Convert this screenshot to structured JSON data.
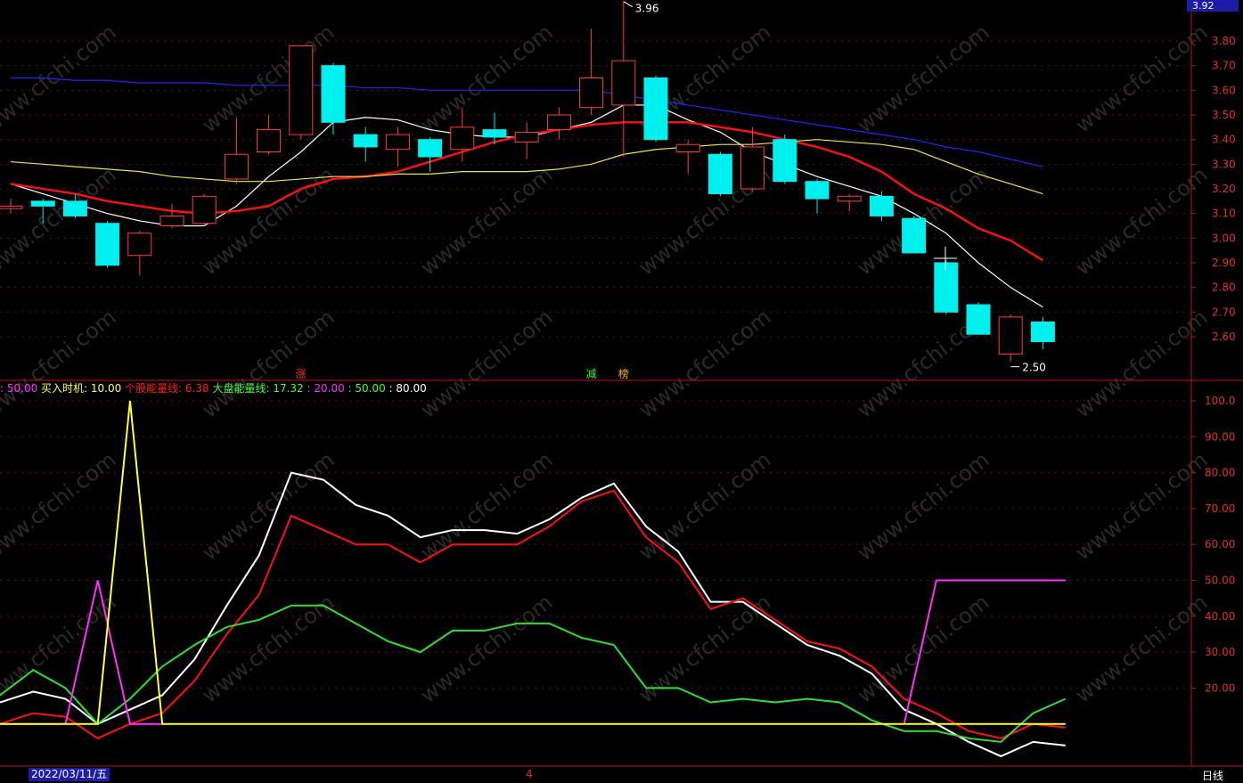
{
  "chart_data": [
    {
      "type": "candlestick",
      "price_axis": {
        "ylim": [
          2.45,
          3.96
        ],
        "ticks": [
          "3.80",
          "3.70",
          "3.60",
          "3.50",
          "3.40",
          "3.30",
          "3.20",
          "3.10",
          "3.00",
          "2.90",
          "2.80",
          "2.70",
          "2.60"
        ],
        "current_tag": "3.92"
      },
      "annotations": {
        "high_label": "3.96",
        "low_label": "2.50"
      },
      "candles": [
        {
          "o": 3.12,
          "c": 3.13,
          "h": 3.16,
          "l": 3.1
        },
        {
          "o": 3.15,
          "c": 3.13,
          "h": 3.16,
          "l": 3.06
        },
        {
          "o": 3.15,
          "c": 3.09,
          "h": 3.18,
          "l": 3.08
        },
        {
          "o": 3.06,
          "c": 2.89,
          "h": 3.07,
          "l": 2.88
        },
        {
          "o": 2.93,
          "c": 3.02,
          "h": 3.03,
          "l": 2.85
        },
        {
          "o": 3.05,
          "c": 3.09,
          "h": 3.14,
          "l": 3.04
        },
        {
          "o": 3.06,
          "c": 3.17,
          "h": 3.18,
          "l": 3.05
        },
        {
          "o": 3.24,
          "c": 3.34,
          "h": 3.49,
          "l": 3.22
        },
        {
          "o": 3.35,
          "c": 3.44,
          "h": 3.5,
          "l": 3.34
        },
        {
          "o": 3.42,
          "c": 3.78,
          "h": 3.78,
          "l": 3.4
        },
        {
          "o": 3.7,
          "c": 3.47,
          "h": 3.71,
          "l": 3.42
        },
        {
          "o": 3.42,
          "c": 3.37,
          "h": 3.45,
          "l": 3.31
        },
        {
          "o": 3.36,
          "c": 3.42,
          "h": 3.45,
          "l": 3.29
        },
        {
          "o": 3.4,
          "c": 3.33,
          "h": 3.41,
          "l": 3.27
        },
        {
          "o": 3.36,
          "c": 3.45,
          "h": 3.53,
          "l": 3.31
        },
        {
          "o": 3.44,
          "c": 3.41,
          "h": 3.51,
          "l": 3.38
        },
        {
          "o": 3.39,
          "c": 3.43,
          "h": 3.47,
          "l": 3.32
        },
        {
          "o": 3.44,
          "c": 3.5,
          "h": 3.53,
          "l": 3.4
        },
        {
          "o": 3.53,
          "c": 3.65,
          "h": 3.85,
          "l": 3.5
        },
        {
          "o": 3.54,
          "c": 3.72,
          "h": 3.96,
          "l": 3.33
        },
        {
          "o": 3.65,
          "c": 3.4,
          "h": 3.66,
          "l": 3.39
        },
        {
          "o": 3.35,
          "c": 3.38,
          "h": 3.4,
          "l": 3.26
        },
        {
          "o": 3.34,
          "c": 3.18,
          "h": 3.35,
          "l": 3.17
        },
        {
          "o": 3.2,
          "c": 3.37,
          "h": 3.45,
          "l": 3.19
        },
        {
          "o": 3.4,
          "c": 3.23,
          "h": 3.42,
          "l": 3.22
        },
        {
          "o": 3.23,
          "c": 3.16,
          "h": 3.24,
          "l": 3.1
        },
        {
          "o": 3.15,
          "c": 3.17,
          "h": 3.18,
          "l": 3.11
        },
        {
          "o": 3.17,
          "c": 3.09,
          "h": 3.19,
          "l": 3.07
        },
        {
          "o": 3.08,
          "c": 2.94,
          "h": 3.09,
          "l": 2.94
        },
        {
          "o": 2.9,
          "c": 2.7,
          "h": 2.91,
          "l": 2.69
        },
        {
          "o": 2.73,
          "c": 2.61,
          "h": 2.74,
          "l": 2.61
        },
        {
          "o": 2.53,
          "c": 2.68,
          "h": 2.69,
          "l": 2.5
        },
        {
          "o": 2.66,
          "c": 2.58,
          "h": 2.68,
          "l": 2.55
        }
      ],
      "series": [
        {
          "color": "#ffffff",
          "values": [
            3.22,
            3.18,
            3.14,
            3.1,
            3.07,
            3.05,
            3.05,
            3.13,
            3.25,
            3.35,
            3.47,
            3.49,
            3.48,
            3.44,
            3.42,
            3.41,
            3.41,
            3.44,
            3.47,
            3.54,
            3.54,
            3.48,
            3.43,
            3.35,
            3.3,
            3.25,
            3.21,
            3.17,
            3.1,
            3.02,
            2.9,
            2.8,
            2.72
          ]
        },
        {
          "color": "#ff1010",
          "values": [
            3.22,
            3.2,
            3.18,
            3.15,
            3.13,
            3.11,
            3.1,
            3.11,
            3.13,
            3.2,
            3.24,
            3.25,
            3.27,
            3.31,
            3.35,
            3.39,
            3.42,
            3.44,
            3.46,
            3.47,
            3.47,
            3.47,
            3.45,
            3.43,
            3.4,
            3.37,
            3.33,
            3.27,
            3.18,
            3.12,
            3.04,
            2.99,
            2.91
          ]
        },
        {
          "color": "#e8e844",
          "values": [
            3.31,
            3.3,
            3.29,
            3.28,
            3.27,
            3.25,
            3.24,
            3.23,
            3.23,
            3.24,
            3.25,
            3.25,
            3.26,
            3.26,
            3.27,
            3.27,
            3.27,
            3.28,
            3.3,
            3.34,
            3.36,
            3.37,
            3.38,
            3.38,
            3.39,
            3.4,
            3.39,
            3.38,
            3.36,
            3.31,
            3.26,
            3.22,
            3.18
          ]
        },
        {
          "color": "#2424ff",
          "values": [
            3.65,
            3.65,
            3.64,
            3.64,
            3.63,
            3.63,
            3.63,
            3.62,
            3.62,
            3.62,
            3.62,
            3.61,
            3.61,
            3.6,
            3.6,
            3.6,
            3.6,
            3.6,
            3.6,
            3.58,
            3.56,
            3.54,
            3.52,
            3.5,
            3.48,
            3.46,
            3.44,
            3.42,
            3.4,
            3.37,
            3.35,
            3.32,
            3.29
          ]
        }
      ],
      "events": [
        {
          "label": "涨",
          "color": "#ff3030",
          "index": 9
        },
        {
          "label": "减",
          "color": "#30ff30",
          "index": 18
        },
        {
          "label": "榜",
          "color": "#ffb020",
          "index": 19
        }
      ]
    },
    {
      "type": "line",
      "ylim": [
        0,
        104
      ],
      "ticks": [
        "100.0",
        "90.00",
        "80.00",
        "70.00",
        "60.00",
        "50.00",
        "40.00",
        "30.00",
        "20.00"
      ],
      "legend": [
        {
          "text": ": 50.00",
          "color": "#ff30ff"
        },
        {
          "text": " 买入时机: 10.00",
          "color": "#ffff40"
        },
        {
          "text": " 个股能量线: 6.38",
          "color": "#ff2020"
        },
        {
          "text": " 大盘能量线: 17.32",
          "color": "#40ff40"
        },
        {
          "text": " : 20.00",
          "color": "#ff30ff"
        },
        {
          "text": " : 50.00",
          "color": "#40ff40"
        },
        {
          "text": " : 80.00",
          "color": "#ffffff"
        }
      ],
      "series": [
        {
          "color": "#ffffff",
          "values": [
            16,
            19,
            17,
            10,
            14,
            18,
            28,
            43,
            57,
            80,
            78,
            71,
            68,
            62,
            64,
            64,
            63,
            67,
            73,
            77,
            65,
            58,
            44,
            44,
            38,
            32,
            29,
            24,
            14,
            10,
            5,
            1,
            5,
            4
          ]
        },
        {
          "color": "#ff1010",
          "values": [
            10,
            13,
            12,
            6,
            10,
            13,
            22,
            35,
            46,
            68,
            64,
            60,
            60,
            55,
            60,
            60,
            60,
            65,
            72,
            75,
            62,
            55,
            42,
            45,
            39,
            33,
            31,
            26,
            17,
            13,
            8,
            6,
            10,
            9
          ]
        },
        {
          "color": "#30e030",
          "values": [
            18,
            25,
            20,
            10,
            17,
            26,
            32,
            37,
            39,
            43,
            43,
            38,
            33,
            30,
            36,
            36,
            38,
            38,
            34,
            32,
            20,
            20,
            16,
            17,
            16,
            17,
            16,
            11,
            8,
            8,
            6,
            5,
            13,
            17
          ]
        },
        {
          "color": "#ff30ff",
          "values": [
            10,
            10,
            10,
            50,
            10,
            10,
            null,
            null,
            null,
            null,
            null,
            null,
            null,
            null,
            null,
            null,
            null,
            null,
            null,
            null,
            null,
            null,
            null,
            null,
            null,
            null,
            null,
            null,
            10,
            50,
            50,
            50,
            50,
            50
          ]
        },
        {
          "color": "#ffff40",
          "values": [
            10,
            10,
            10,
            10,
            100,
            10,
            10,
            10,
            10,
            10,
            10,
            10,
            10,
            10,
            10,
            10,
            10,
            10,
            10,
            10,
            10,
            10,
            10,
            10,
            10,
            10,
            10,
            10,
            10,
            10,
            10,
            10,
            10,
            10
          ]
        }
      ]
    }
  ],
  "footer": {
    "date": "2022/03/11/五",
    "page": "4",
    "period": "日线"
  },
  "watermark": "www.cfchi.com"
}
